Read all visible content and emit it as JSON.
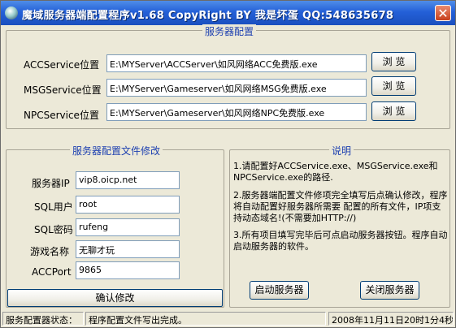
{
  "window": {
    "title": "魔域服务器端配置程序v1.68  CopyRight BY 我是坏蛋 QQ:548635678",
    "close_glyph": "✕"
  },
  "server_config": {
    "title": "服务器配置",
    "browse_label": "浏 览",
    "rows": [
      {
        "label": "ACCService位置",
        "value": "E:\\MYServer\\ACCServer\\如风网络ACC免费版.exe"
      },
      {
        "label": "MSGService位置",
        "value": "E:\\MYServer\\Gameserver\\如风网络MSG免费版.exe"
      },
      {
        "label": "NPCService位置",
        "value": "E:\\MYServer\\Gameserver\\如风网络NPC免费版.exe"
      }
    ]
  },
  "file_edit": {
    "title": "服务器配置文件修改",
    "fields": [
      {
        "label": "服务器IP",
        "value": "vip8.oicp.net"
      },
      {
        "label": "SQL用户",
        "value": "root"
      },
      {
        "label": "SQL密码",
        "value": "rufeng"
      },
      {
        "label": "游戏名称",
        "value": "无聊才玩"
      },
      {
        "label": "ACCPort",
        "value": "9865"
      }
    ],
    "confirm_label": "确认修改"
  },
  "notes": {
    "title": "说明",
    "items": [
      "1.请配置好ACCService.exe、MSGService.exe和NPCService.exe的路径.",
      "2.服务器端配置文件修项完全填写后点确认修改，程序将自动配置好服务器所需要    配置的所有文件，IP项支持动态域名!(不需要加HTTP://)",
      "3.所有项目填写完毕后可点启动服务器按钮。程序自动启动服务器的软件。"
    ],
    "start_label": "启动服务器",
    "stop_label": "关闭服务器"
  },
  "status": {
    "label": "服务配置器状态：",
    "message": "程序配置文件写出完成。",
    "datetime": "2008年11月11日20时1分4秒"
  }
}
